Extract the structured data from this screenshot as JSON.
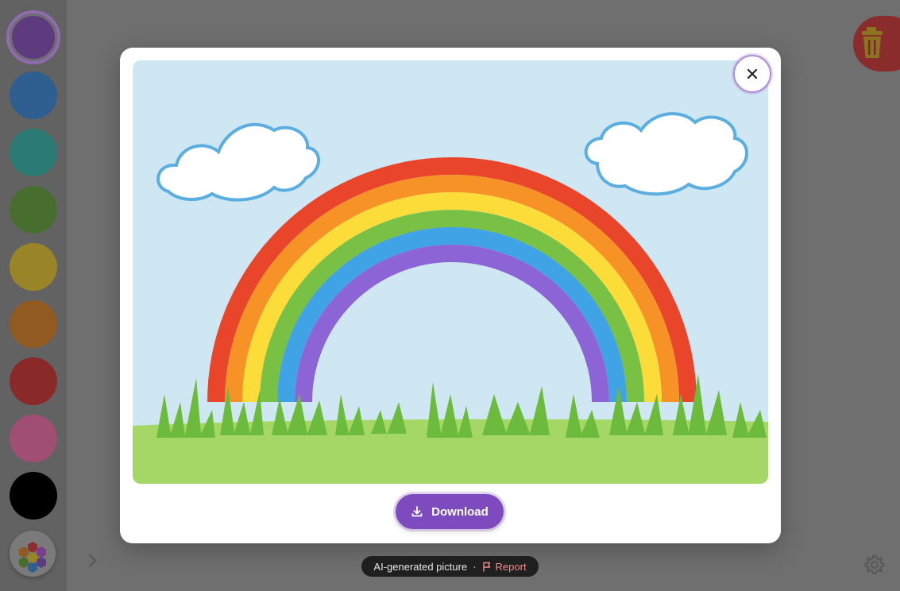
{
  "sidebar": {
    "swatches": [
      {
        "name": "purple",
        "color": "#5e3a7e",
        "selected": true
      },
      {
        "name": "blue",
        "color": "#2f5f90"
      },
      {
        "name": "teal",
        "color": "#2b7a74"
      },
      {
        "name": "green",
        "color": "#476e2e"
      },
      {
        "name": "yellow",
        "color": "#9a8428"
      },
      {
        "name": "orange",
        "color": "#915a21"
      },
      {
        "name": "red",
        "color": "#8a2a28"
      },
      {
        "name": "pink",
        "color": "#a04e72"
      },
      {
        "name": "black",
        "color": "#000000"
      }
    ],
    "palette_icon": "color-palette-icon",
    "expand_icon": "chevron-right-icon"
  },
  "toolbar": {
    "trash_icon": "trash-icon",
    "settings_icon": "gear-icon"
  },
  "modal": {
    "close_icon": "close-icon",
    "image": "rainbow-with-clouds-and-grass",
    "download_label": "Download",
    "download_icon": "download-icon"
  },
  "footer": {
    "ai_label": "AI-generated picture",
    "separator": "·",
    "report_label": "Report",
    "report_icon": "flag-icon"
  },
  "colors": {
    "accent": "#7e4bbf",
    "report": "#f28c8c"
  }
}
